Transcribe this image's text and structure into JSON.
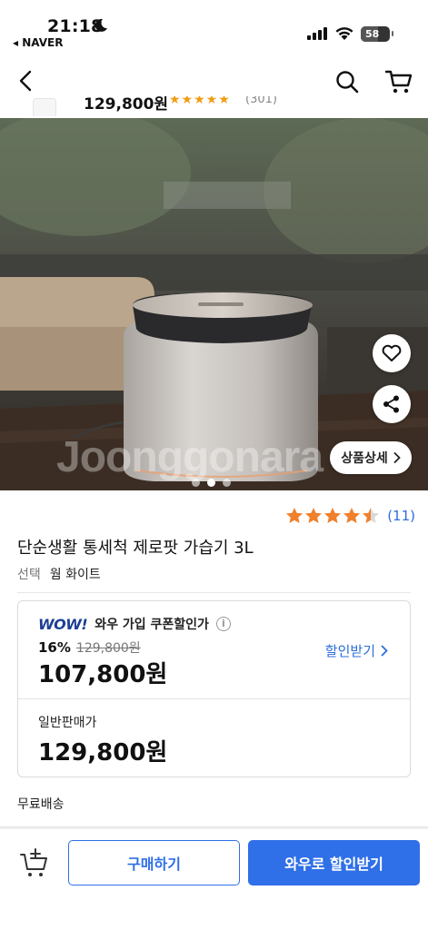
{
  "status_bar": {
    "time": "21:18",
    "back_app": "◂ NAVER",
    "battery": "58",
    "battery_level": 0.58
  },
  "nav": {
    "icons": [
      "back-icon",
      "search-icon",
      "cart-icon"
    ]
  },
  "mini_header": {
    "price": "129,800원",
    "stars": "★★★★★",
    "count": "(301)"
  },
  "hero": {
    "watermark": "Joonggonara",
    "detail_button": "상품상세",
    "slide_count": 3,
    "active_slide": 1
  },
  "product": {
    "rating_stars": "★★★★☆",
    "rating_value": 4.5,
    "review_count": "(11)",
    "title": "단순생활 통세척 제로팟 가습기 3L",
    "option_label": "선택",
    "option_value": "웜 화이트"
  },
  "price_box": {
    "wow_logo": "WOW!",
    "wow_label": "와우 가입 쿠폰할인가",
    "discount_rate": "16%",
    "original_price": "129,800원",
    "wow_price": "107,800원",
    "coupon_link": "할인받기",
    "normal_label": "일반판매가",
    "normal_price": "129,800원"
  },
  "shipping": "무료배송",
  "bottom_bar": {
    "buy_label": "구매하기",
    "wow_buy_label": "와우로 할인받기"
  },
  "colors": {
    "accent_blue": "#2f6fe8",
    "wow_navy": "#1c3f95",
    "star_orange": "#f0802c"
  }
}
